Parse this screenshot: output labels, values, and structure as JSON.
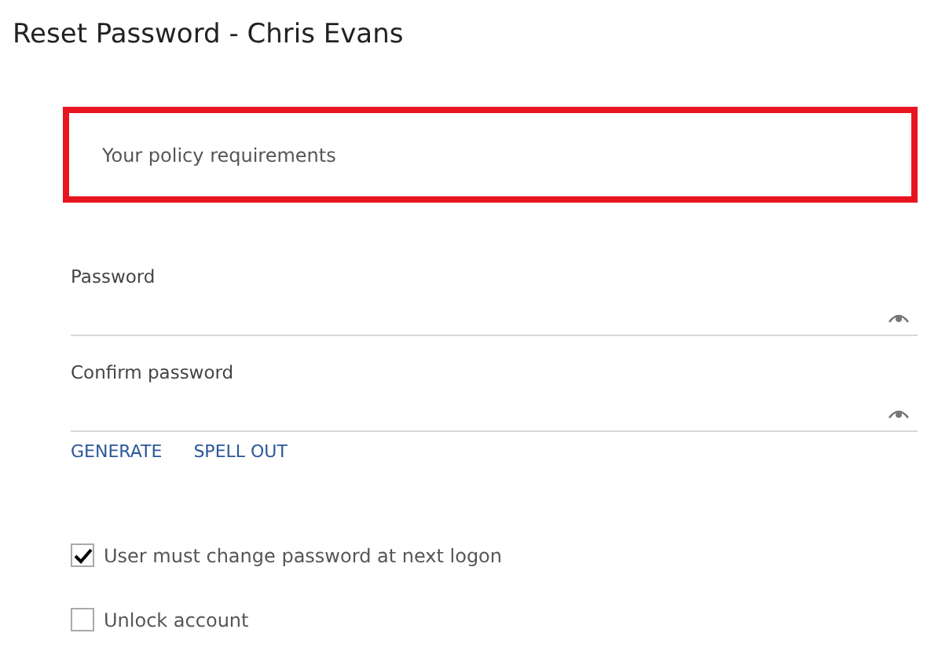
{
  "window": {
    "title": "Reset Password - Chris Evans"
  },
  "policy": {
    "text": "Your policy requirements"
  },
  "fields": [
    {
      "label": "Password"
    },
    {
      "label": "Confirm password"
    }
  ],
  "links": [
    "GENERATE",
    "SPELL OUT"
  ],
  "options": [
    {
      "label": "User must change password at next logon",
      "checked": true
    },
    {
      "label": "Unlock account",
      "checked": false
    }
  ]
}
